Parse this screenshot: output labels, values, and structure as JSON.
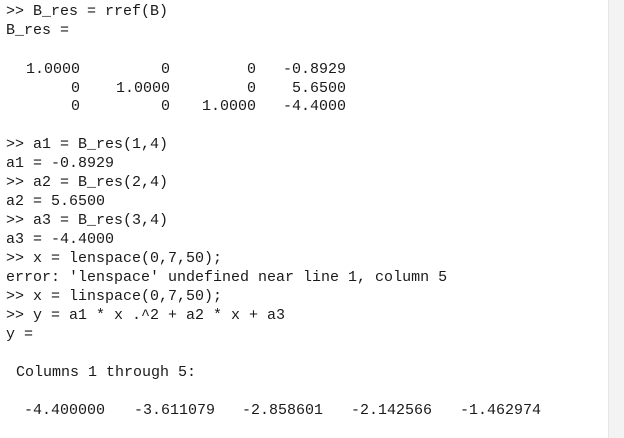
{
  "console": {
    "lines": [
      ">> B_res = rref(B)",
      "B_res =",
      ">> a1 = B_res(1,4)",
      "a1 = -0.8929",
      ">> a2 = B_res(2,4)",
      "a2 = 5.6500",
      ">> a3 = B_res(3,4)",
      "a3 = -4.4000",
      ">> x = lenspace(0,7,50);",
      "error: 'lenspace' undefined near line 1, column 5",
      ">> x = linspace(0,7,50);",
      ">> y = a1 * x .^2 + a2 * x + a3",
      "y =",
      " Columns 1 through 5:"
    ],
    "matrix": [
      [
        "1.0000",
        "0",
        "0",
        "-0.8929"
      ],
      [
        "0",
        "1.0000",
        "0",
        "5.6500"
      ],
      [
        "0",
        "0",
        "1.0000",
        "-4.4000"
      ]
    ],
    "y_values": [
      "-4.400000",
      "-3.611079",
      "-2.858601",
      "-2.142566",
      "-1.462974"
    ]
  }
}
